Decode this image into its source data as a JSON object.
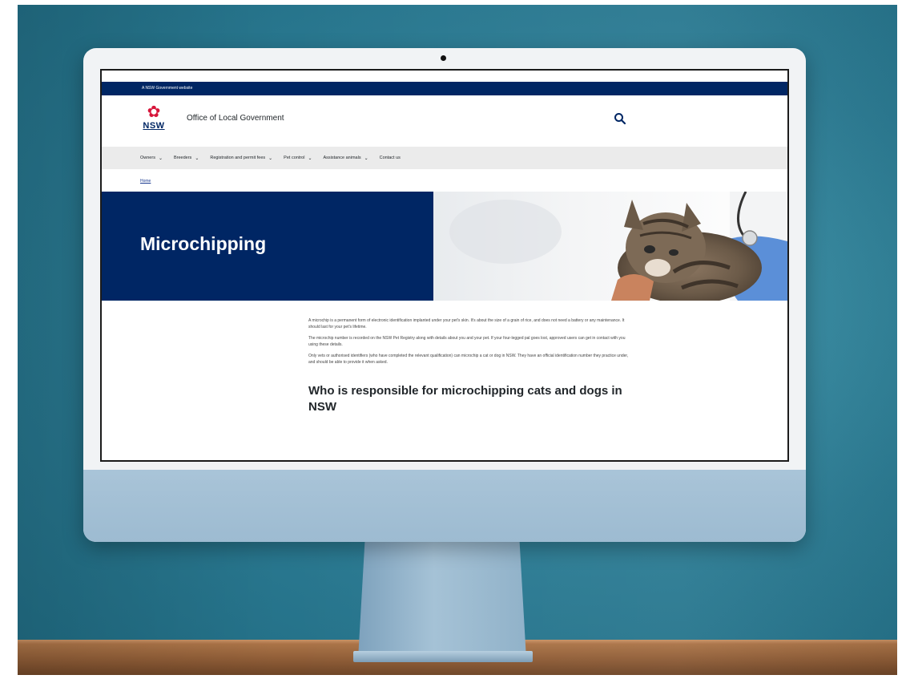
{
  "gov_bar": {
    "text": "A NSW Government website"
  },
  "header": {
    "logo_text": "NSW",
    "site_title": "Office of Local Government"
  },
  "nav": {
    "items": [
      {
        "label": "Owners"
      },
      {
        "label": "Breeders"
      },
      {
        "label": "Registration and permit fees"
      },
      {
        "label": "Pet control"
      },
      {
        "label": "Assistance animals"
      },
      {
        "label": "Contact us"
      }
    ]
  },
  "breadcrumb": {
    "home": "Home"
  },
  "hero": {
    "title": "Microchipping"
  },
  "content": {
    "paragraphs": [
      "A microchip is a permanent form of electronic identification implanted under your pet's skin. It's about the size of a grain of rice, and does not need a battery or any maintenance. It should last for your pet's lifetime.",
      "The microchip number is recorded on the NSW Pet Registry along with details about you and your pet. If your four-legged pal goes lost, approved users can get in contact with you using these details.",
      "Only vets or authorised identifiers (who have completed the relevant qualification) can microchip a cat or dog in NSW. They have an official identification number they practice under, and should be able to provide it when asked."
    ],
    "heading": "Who is responsible for microchipping cats and dogs in NSW"
  },
  "colors": {
    "nsw_blue": "#002664",
    "nsw_red": "#d7153a",
    "scene_teal": "#2d7d95"
  }
}
